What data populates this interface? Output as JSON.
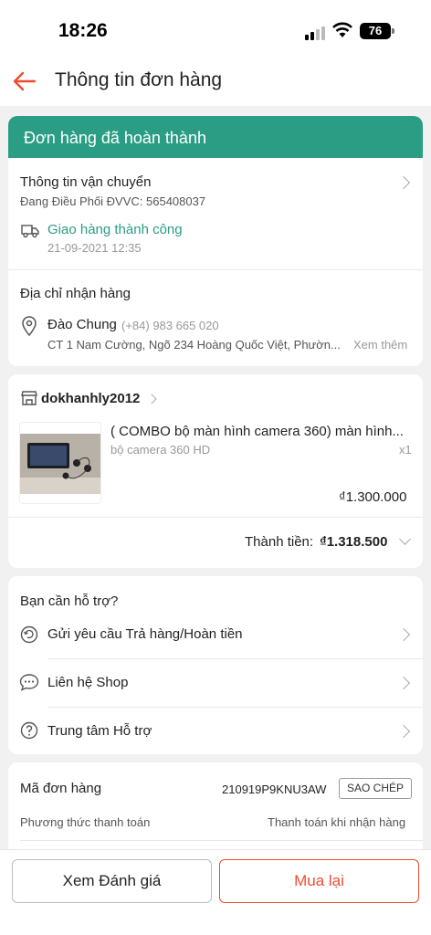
{
  "status_bar": {
    "time": "18:26",
    "battery": "76"
  },
  "header": {
    "title": "Thông tin đơn hàng"
  },
  "order_status": {
    "banner": "Đơn hàng đã hoàn thành",
    "banner_color": "#2a9d84"
  },
  "shipping": {
    "title": "Thông tin vận chuyển",
    "carrier_line": "Đang Điều Phối ĐVVC: 565408037",
    "status": "Giao hàng thành công",
    "timestamp": "21-09-2021 12:35"
  },
  "address": {
    "title": "Địa chỉ nhận hàng",
    "name": "Đào Chung",
    "phone": "(+84) 983 665 020",
    "line": "CT 1 Nam Cường, Ngõ 234 Hoàng Quốc Việt, Phườn...",
    "see_more": "Xem thêm"
  },
  "shop": {
    "name": "dokhanhly2012"
  },
  "product": {
    "name": "( COMBO bộ màn hình camera 360) màn hình...",
    "variant": "bộ camera 360 HD",
    "quantity": "x1",
    "price": "₫1.300.000"
  },
  "total": {
    "label": "Thành tiền:",
    "value": "₫1.318.500"
  },
  "support": {
    "title": "Bạn cần hỗ trợ?",
    "items": [
      {
        "label": "Gửi yêu cầu Trả hàng/Hoàn tiền",
        "icon": "return-icon"
      },
      {
        "label": "Liên hệ Shop",
        "icon": "chat-icon"
      },
      {
        "label": "Trung tâm Hỗ trợ",
        "icon": "help-icon"
      }
    ]
  },
  "order_info": {
    "code_label": "Mã đơn hàng",
    "code": "210919P9KNU3AW",
    "copy_label": "SAO CHÉP",
    "payment_label": "Phương thức thanh toán",
    "payment_value": "Thanh toán khi nhận hàng"
  },
  "actions": {
    "review": "Xem Đánh giá",
    "rebuy": "Mua lại"
  },
  "colors": {
    "accent": "#ee4d2d",
    "success": "#2a9d84"
  }
}
